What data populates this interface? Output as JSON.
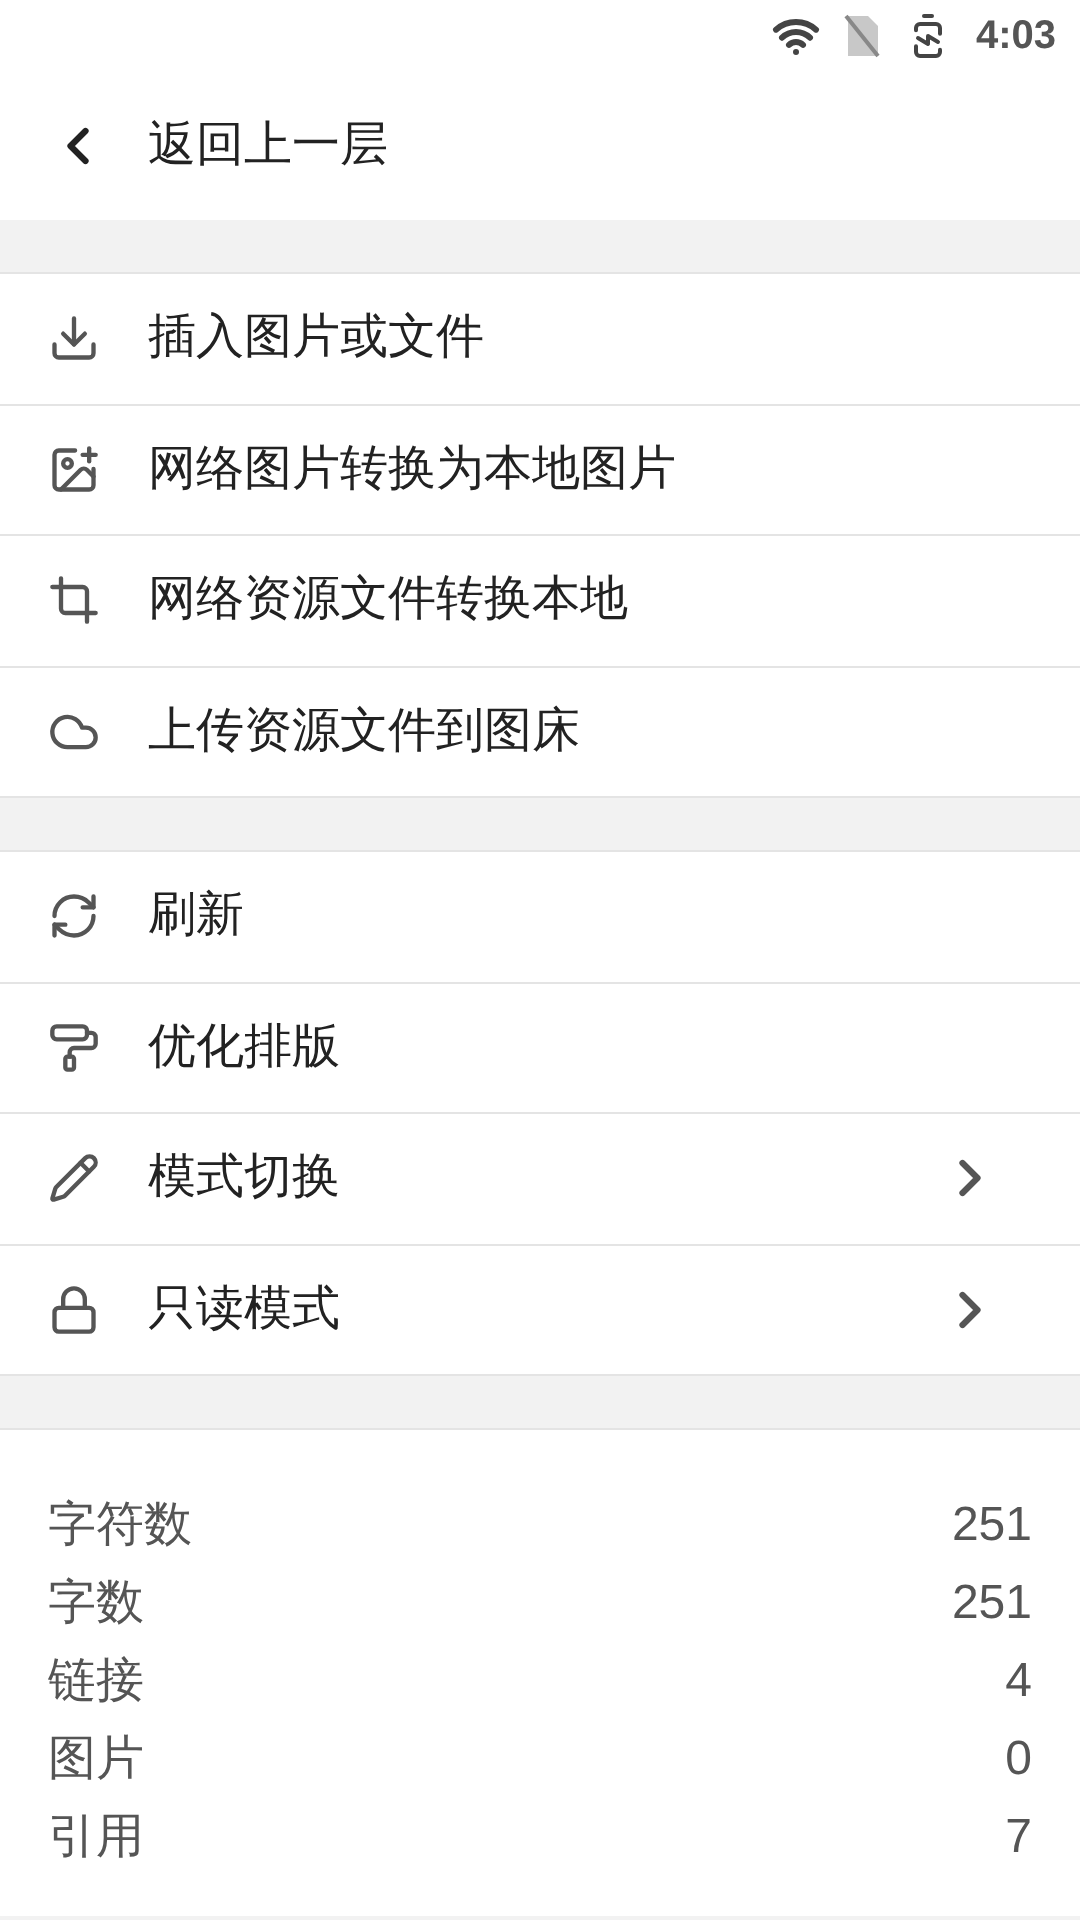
{
  "status_bar": {
    "time": "4:03"
  },
  "header": {
    "back_label": "返回上一层"
  },
  "menu_groups": [
    {
      "items": [
        {
          "label": "插入图片或文件",
          "has_submenu": false
        },
        {
          "label": "网络图片转换为本地图片",
          "has_submenu": false
        },
        {
          "label": "网络资源文件转换本地",
          "has_submenu": false
        },
        {
          "label": "上传资源文件到图床",
          "has_submenu": false
        }
      ]
    },
    {
      "items": [
        {
          "label": "刷新",
          "has_submenu": false
        },
        {
          "label": "优化排版",
          "has_submenu": false
        },
        {
          "label": "模式切换",
          "has_submenu": true
        },
        {
          "label": "只读模式",
          "has_submenu": true
        }
      ]
    }
  ],
  "stats": [
    {
      "label": "字符数",
      "value": "251"
    },
    {
      "label": "字数",
      "value": "251"
    },
    {
      "label": "链接",
      "value": "4"
    },
    {
      "label": "图片",
      "value": "0"
    },
    {
      "label": "引用",
      "value": "7"
    }
  ]
}
